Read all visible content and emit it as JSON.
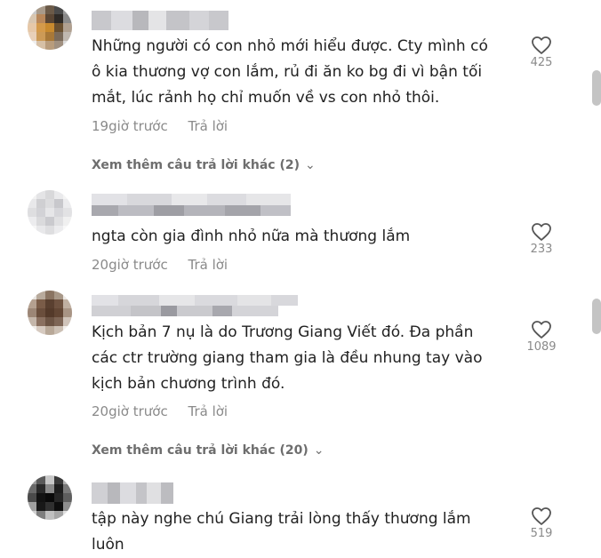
{
  "comments": [
    {
      "text": "Những người có con nhỏ mới hiểu được. Cty mình có ô kia thương vợ con lắm, rủ đi ăn ko bg đi vì bận tối mắt, lúc rảnh họ chỉ muốn về vs con nhỏ thôi.",
      "time": "19giờ trước",
      "reply": "Trả lời",
      "likes": "425",
      "more": "Xem thêm câu trả lời khác (2)"
    },
    {
      "text": "ngta còn gia đình nhỏ nữa mà thương lắm",
      "time": "20giờ trước",
      "reply": "Trả lời",
      "likes": "233"
    },
    {
      "text": "Kịch bản 7 nụ là do Trương Giang Viết đó. Đa phần các ctr trường giang tham gia là đều nhung tay vào kịch bản chương trình đó.",
      "time": "20giờ trước",
      "reply": "Trả lời",
      "likes": "1089",
      "more": "Xem thêm câu trả lời khác (20)"
    },
    {
      "text": "tập này nghe chú Giang trải lòng thấy thương lắm luôn",
      "likes": "519"
    }
  ],
  "icons": {
    "like": "heart-outline-icon",
    "expand": "chevron-down-icon"
  },
  "colors": {
    "text": "#222222",
    "meta": "#8a8a8a",
    "more": "#6e6e6e",
    "scrollbar": "#c4c4c4"
  }
}
